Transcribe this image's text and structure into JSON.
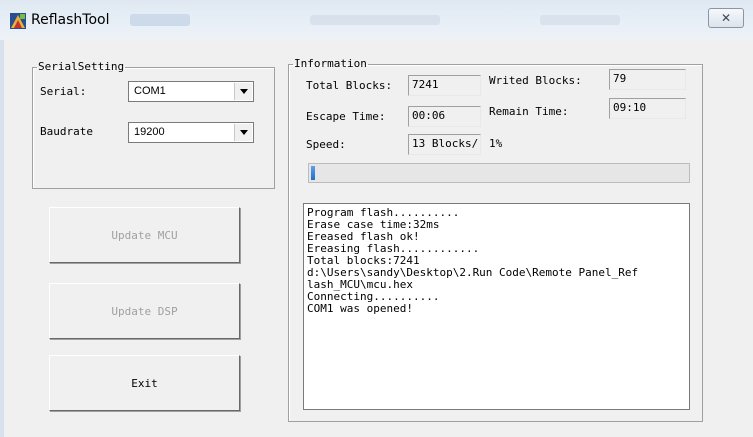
{
  "window": {
    "title": "ReflashTool",
    "close_glyph": "✕"
  },
  "serial_setting": {
    "legend": "SerialSetting",
    "serial_label": "Serial:",
    "serial_value": "COM1",
    "baudrate_label": "Baudrate",
    "baudrate_value": "19200"
  },
  "buttons": {
    "update_mcu": "Update MCU",
    "update_dsp": "Update DSP",
    "exit": "Exit"
  },
  "information": {
    "legend": "Information",
    "total_blocks_label": "Total Blocks:",
    "total_blocks_value": "7241",
    "writed_blocks_label": "Writed Blocks:",
    "writed_blocks_value": "79",
    "escape_time_label": "Escape Time:",
    "escape_time_value": "00:06",
    "remain_time_label": "Remain Time:",
    "remain_time_value": "09:10",
    "speed_label": "Speed:",
    "speed_value": "13 Blocks/",
    "percent_text": "1%",
    "progress_fraction": 0.01
  },
  "log_lines": [
    "Program flash..........",
    "Erase case time:32ms",
    "Ereased flash ok!",
    "Ereasing flash............",
    "Total blocks:7241",
    "d:\\Users\\sandy\\Desktop\\2.Run Code\\Remote Panel_Ref",
    "lash_MCU\\mcu.hex",
    "Connecting..........",
    "COM1 was opened!"
  ],
  "colors": {
    "progress_fill": "#1e6fd0",
    "window_bg": "#f0f0f0"
  }
}
